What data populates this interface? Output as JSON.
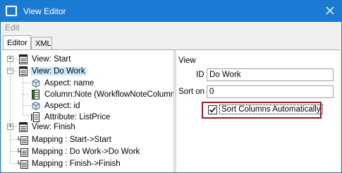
{
  "window": {
    "title": "View Editor"
  },
  "menu": {
    "edit": "Edit"
  },
  "tabs": {
    "editor": "Editor",
    "xml": "XML"
  },
  "tree": {
    "view_start": "View: Start",
    "view_dowork": "View: Do Work",
    "aspect_name": "Aspect: name",
    "column_note": "Column:Note (WorkflowNoteColumn)",
    "aspect_id": "Aspect: id",
    "attribute_listprice": "Attribute: ListPrice",
    "view_finish": "View: Finish",
    "mapping_start": "Mapping : Start->Start",
    "mapping_dowork": "Mapping : Do Work->Do Work",
    "mapping_finish": "Mapping : Finish->Finish"
  },
  "properties": {
    "section": "View",
    "id_label": "ID",
    "id_value": "Do Work",
    "sorton_label": "Sort on",
    "sorton_value": "0",
    "sort_columns_label": "Sort Columns Automatically",
    "sort_columns_checked": true
  },
  "colors": {
    "titlebar": "#1a7bd4",
    "selection": "#cce8ff",
    "highlight_border": "#9b1c26"
  },
  "icons": [
    "app-icon",
    "close-icon",
    "view-icon",
    "aspect-icon",
    "column-icon",
    "attribute-icon",
    "mapping-icon",
    "checkmark-icon"
  ]
}
